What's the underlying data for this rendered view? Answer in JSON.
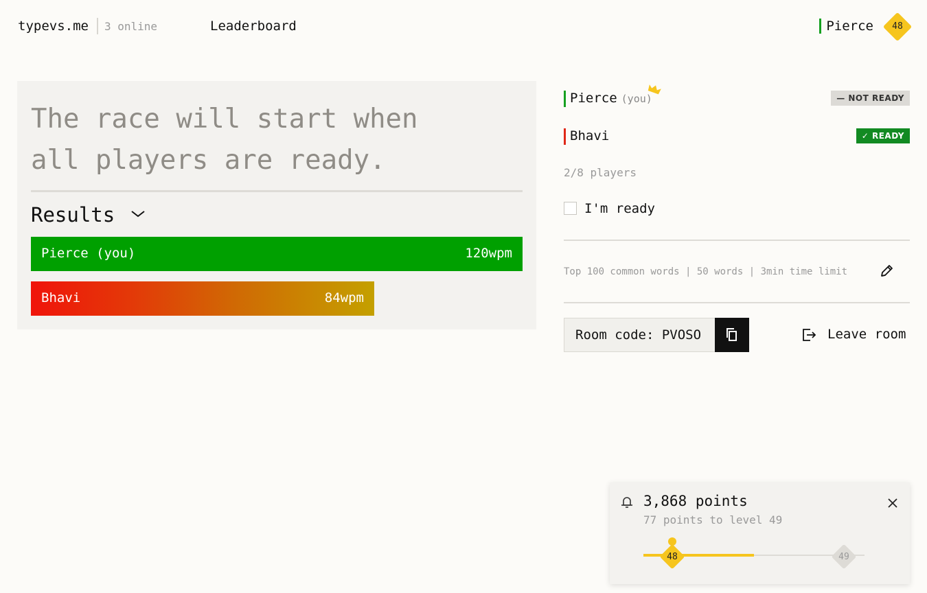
{
  "header": {
    "logo": "typevs.me",
    "online": "3 online",
    "nav_leaderboard": "Leaderboard",
    "username": "Pierce",
    "level": "48"
  },
  "race": {
    "message": "The race will start when all players are ready.",
    "results_title": "Results",
    "results": [
      {
        "name": "Pierce (you)",
        "wpm_label": "120wpm",
        "wpm": 120
      },
      {
        "name": "Bhavi",
        "wpm_label": "84wpm",
        "wpm": 84
      }
    ]
  },
  "room": {
    "players": [
      {
        "name": "Pierce",
        "you_tag": "(you)",
        "status": "— NOT READY",
        "is_host": true
      },
      {
        "name": "Bhavi",
        "status": "✓ READY"
      }
    ],
    "players_count": "2/8 players",
    "ready_label": "I'm ready",
    "ready_checked": false,
    "settings": "Top 100 common words | 50 words | 3min time limit",
    "room_code": "Room code: PVOSO",
    "leave_label": "Leave room"
  },
  "toast": {
    "points": "3,868 points",
    "sub": "77 points to level 49",
    "current_level": "48",
    "next_level": "49",
    "progress": 0.5
  },
  "colors": {
    "accent_yellow": "#f6c51e",
    "ready_green": "#128a22",
    "bar_green": "#00a000",
    "player_red": "#e02818"
  }
}
